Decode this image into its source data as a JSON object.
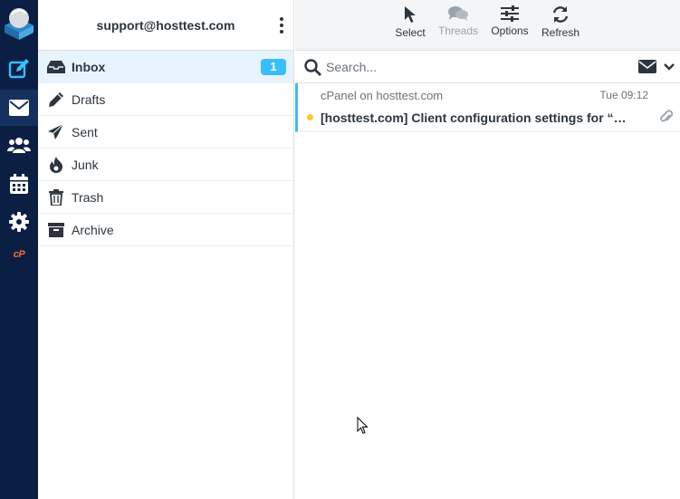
{
  "account": {
    "email": "support@hosttest.com"
  },
  "rail": {
    "items": [
      {
        "name": "compose",
        "icon": "compose-icon"
      },
      {
        "name": "mail",
        "icon": "envelope-icon"
      },
      {
        "name": "contacts",
        "icon": "users-icon"
      },
      {
        "name": "calendar",
        "icon": "calendar-icon"
      },
      {
        "name": "settings",
        "icon": "gear-icon"
      },
      {
        "name": "cpanel",
        "label": "cP"
      }
    ]
  },
  "folders": [
    {
      "label": "Inbox",
      "icon": "inbox-icon",
      "badge": "1"
    },
    {
      "label": "Drafts",
      "icon": "pencil-icon"
    },
    {
      "label": "Sent",
      "icon": "paper-plane-icon"
    },
    {
      "label": "Junk",
      "icon": "fire-icon"
    },
    {
      "label": "Trash",
      "icon": "trash-icon"
    },
    {
      "label": "Archive",
      "icon": "archive-icon"
    }
  ],
  "toolbar": {
    "select": "Select",
    "threads": "Threads",
    "options": "Options",
    "refresh": "Refresh"
  },
  "search": {
    "placeholder": "Search..."
  },
  "messages": [
    {
      "from": "cPanel on hosttest.com",
      "date": "Tue 09:12",
      "subject": "[hosttest.com] Client configuration settings for “support@hosttest.com”",
      "unread": true,
      "has_attachment": true
    }
  ],
  "colors": {
    "rail": "#0b1f44",
    "accent": "#37beff",
    "unread_dot": "#ffc43d",
    "active_folder_bg": "#e8f4fd"
  }
}
